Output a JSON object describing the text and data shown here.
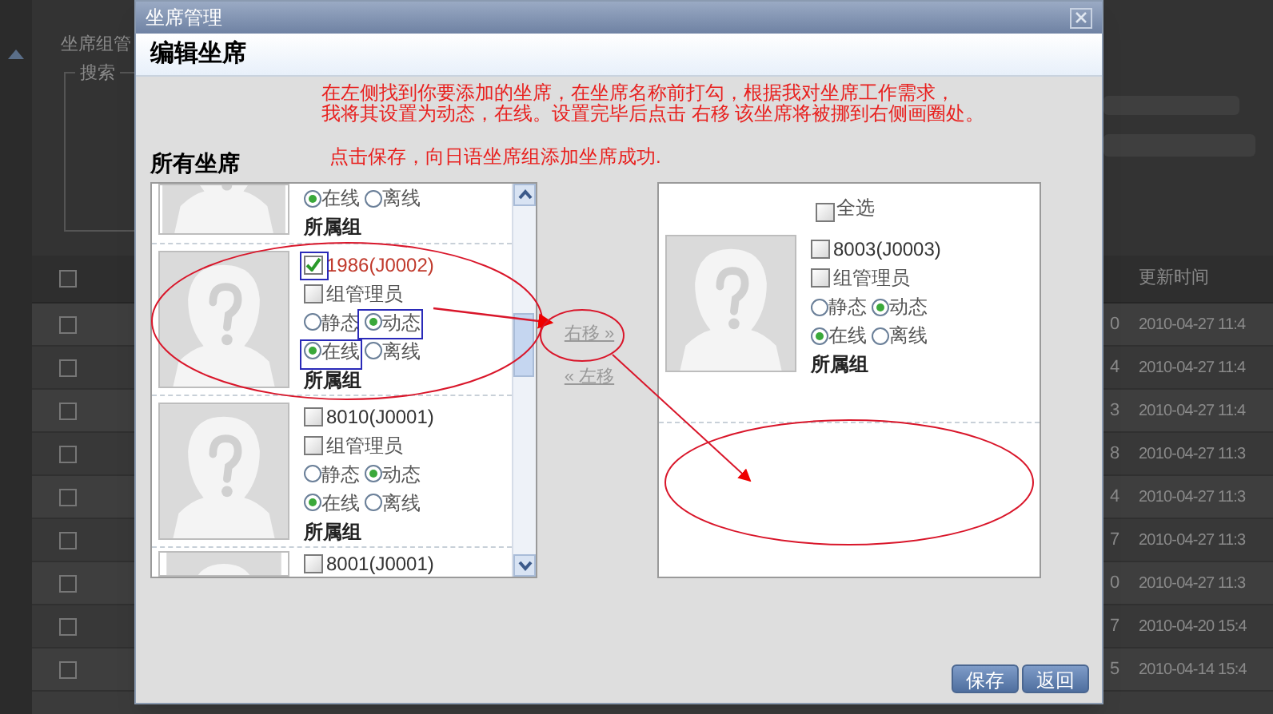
{
  "background_page": {
    "title": "坐席组管",
    "search_legend": "搜索",
    "table": {
      "header_checked": false,
      "header_time": "更新时间",
      "rows": [
        {
          "checked": false,
          "column_2": "0",
          "update_time": "2010-04-27 11:4"
        },
        {
          "checked": false,
          "column_2": "4",
          "update_time": "2010-04-27 11:4"
        },
        {
          "checked": false,
          "column_2": "3",
          "update_time": "2010-04-27 11:4"
        },
        {
          "checked": false,
          "column_2": "8",
          "update_time": "2010-04-27 11:3"
        },
        {
          "checked": false,
          "column_2": "4",
          "update_time": "2010-04-27 11:3"
        },
        {
          "checked": false,
          "column_2": "7",
          "update_time": "2010-04-27 11:3"
        },
        {
          "checked": false,
          "column_2": "0",
          "update_time": "2010-04-27 11:3"
        },
        {
          "checked": false,
          "column_2": "7",
          "update_time": "2010-04-20 15:4"
        },
        {
          "checked": false,
          "column_2": "5",
          "update_time": "2010-04-14 15:4"
        }
      ]
    }
  },
  "dialog": {
    "title": "坐席管理",
    "heading": "编辑坐席",
    "instructions": [
      "在左侧找到你要添加的坐席，在坐席名称前打勾，根据我对坐席工作需求，",
      "我将其设置为动态，在线。设置完毕后点击 右移 该坐席将被挪到右侧画圈处。",
      "点击保存，向日语坐席组添加坐席成功."
    ],
    "all_agents_label": "所有坐席",
    "left_list": [
      {
        "kind": "cut_top",
        "status_options": [
          {
            "label": "在线",
            "selected": true
          },
          {
            "label": "离线",
            "selected": false
          }
        ],
        "group_label": "所属组"
      },
      {
        "kind": "full",
        "name": "1986(J0002)",
        "checked": true,
        "admin_label": "组管理员",
        "admin": false,
        "mode_options": [
          {
            "label": "静态",
            "selected": false
          },
          {
            "label": "动态",
            "selected": true
          }
        ],
        "status_options": [
          {
            "label": "在线",
            "selected": true
          },
          {
            "label": "离线",
            "selected": false
          }
        ],
        "group_label": "所属组"
      },
      {
        "kind": "full",
        "name": "8010(J0001)",
        "checked": false,
        "admin_label": "组管理员",
        "admin": false,
        "mode_options": [
          {
            "label": "静态",
            "selected": false
          },
          {
            "label": "动态",
            "selected": true
          }
        ],
        "status_options": [
          {
            "label": "在线",
            "selected": true
          },
          {
            "label": "离线",
            "selected": false
          }
        ],
        "group_label": "所属组"
      },
      {
        "kind": "cut_bottom",
        "name": "8001(J0001)",
        "checked": false
      }
    ],
    "move_right": "右移 »",
    "move_left": "« 左移",
    "right_list": {
      "select_all": {
        "label": "全选",
        "checked": false
      },
      "items": [
        {
          "kind": "full",
          "name": "8003(J0003)",
          "checked": false,
          "admin_label": "组管理员",
          "admin": false,
          "mode_options": [
            {
              "label": "静态",
              "selected": false
            },
            {
              "label": "动态",
              "selected": true
            }
          ],
          "status_options": [
            {
              "label": "在线",
              "selected": true
            },
            {
              "label": "离线",
              "selected": false
            }
          ],
          "group_label": "所属组"
        }
      ]
    },
    "buttons": [
      "保存",
      "返回"
    ]
  }
}
